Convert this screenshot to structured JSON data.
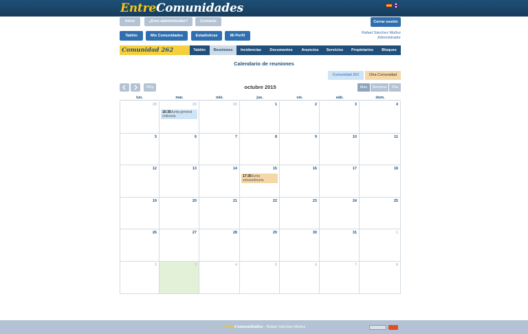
{
  "header": {
    "logo_part1": "Entre",
    "logo_part2": "Comunidades",
    "languages": [
      "spanish-flag-icon",
      "english-flag-icon"
    ]
  },
  "topnav": {
    "inicio": "Inicio",
    "admin_question": "¿Eres administrador?",
    "contacto": "Contacto",
    "logout": "Cerrar sesión"
  },
  "usernav": {
    "tablon": "Tablón",
    "mis_comunidades": "Mis Comunidades",
    "estadisticas": "Estadísticas",
    "mi_perfil": "Mi Perfil"
  },
  "user": {
    "name": "Rafael Sánchez Muñoz",
    "role": "Administrador"
  },
  "community": {
    "name": "Comunidad 262",
    "tabs": [
      "Tablón",
      "Reuniones",
      "Incidencias",
      "Documentos",
      "Anuncios",
      "Servicios",
      "Propietarios",
      "Bloques"
    ],
    "active_tab": "Reuniones"
  },
  "calendar": {
    "title": "Calendario de reuniones",
    "legend": [
      "Comunidad 262",
      "Otra Comunidad"
    ],
    "month": "octubre 2015",
    "prev_icon": "chevron-left-icon",
    "next_icon": "chevron-right-icon",
    "today_label": "Hoy",
    "views": [
      "Mes",
      "Semana",
      "Día"
    ],
    "active_view": "Mes",
    "weekdays": [
      "lun.",
      "mar.",
      "mié.",
      "jue.",
      "vie.",
      "sáb.",
      "dom."
    ],
    "weeks": [
      [
        28,
        29,
        30,
        1,
        2,
        3,
        4
      ],
      [
        5,
        6,
        7,
        8,
        9,
        10,
        11
      ],
      [
        12,
        13,
        14,
        15,
        16,
        17,
        18
      ],
      [
        19,
        20,
        21,
        22,
        23,
        24,
        25
      ],
      [
        26,
        27,
        28,
        29,
        30,
        31,
        1
      ],
      [
        2,
        3,
        4,
        5,
        6,
        7,
        8
      ]
    ],
    "events": [
      {
        "week": 0,
        "day": 1,
        "time": "16:30",
        "title": "Junta general ordinaria",
        "color": "#cfe4f7"
      },
      {
        "week": 2,
        "day": 3,
        "time": "17:30",
        "title": "Junta extraordinaria",
        "color": "#f5d8a8"
      }
    ]
  },
  "footer": {
    "logo_part1": "Entre",
    "logo_part2": "Comunidades",
    "author": " - Rafael Sánchez Muñoz",
    "badges": [
      "w3c-wai-badge-icon",
      "html5-badge-icon"
    ]
  }
}
